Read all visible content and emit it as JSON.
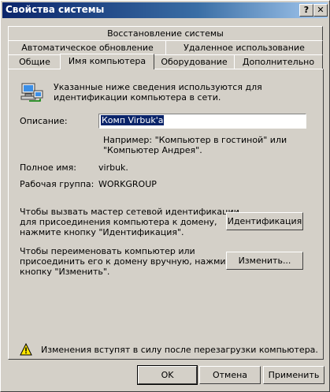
{
  "window": {
    "title": "Свойства системы"
  },
  "titlebar": {
    "help_label": "?",
    "close_label": "✕"
  },
  "tabs": [
    {
      "label": "Восстановление системы"
    },
    {
      "label": "Автоматическое обновление"
    },
    {
      "label": "Удаленное использование"
    },
    {
      "label": "Общие"
    },
    {
      "label": "Имя компьютера"
    },
    {
      "label": "Оборудование"
    },
    {
      "label": "Дополнительно"
    }
  ],
  "panel": {
    "intro_line1": "Указанные ниже сведения используются для",
    "intro_line2": "идентификации компьютера в сети.",
    "description_label": "Описание:",
    "description_value": "Комп Virbuk'a",
    "example_line1": "Например: \"Компьютер в гостиной\" или",
    "example_line2": "\"Компьютер Андрея\".",
    "fullname_label": "Полное имя:",
    "fullname_value": "virbuk.",
    "workgroup_label": "Рабочая группа:",
    "workgroup_value": "WORKGROUP",
    "wizard_line1": "Чтобы вызвать мастер сетевой идентификации",
    "wizard_line2": "для присоединения компьютера к домену,",
    "wizard_line3": "нажмите кнопку \"Идентификация\".",
    "identify_button": "Идентификация",
    "rename_line1": "Чтобы переименовать компьютер или",
    "rename_line2": "присоединить его к домену вручную, нажмите",
    "rename_line3": "кнопку \"Изменить\".",
    "change_button": "Изменить...",
    "warning_text": "Изменения вступят в силу после перезагрузки компьютера."
  },
  "footer": {
    "ok": "OK",
    "cancel": "Отмена",
    "apply": "Применить"
  },
  "icons": {
    "computer": "computer-network-icon",
    "warning": "warning-icon"
  }
}
